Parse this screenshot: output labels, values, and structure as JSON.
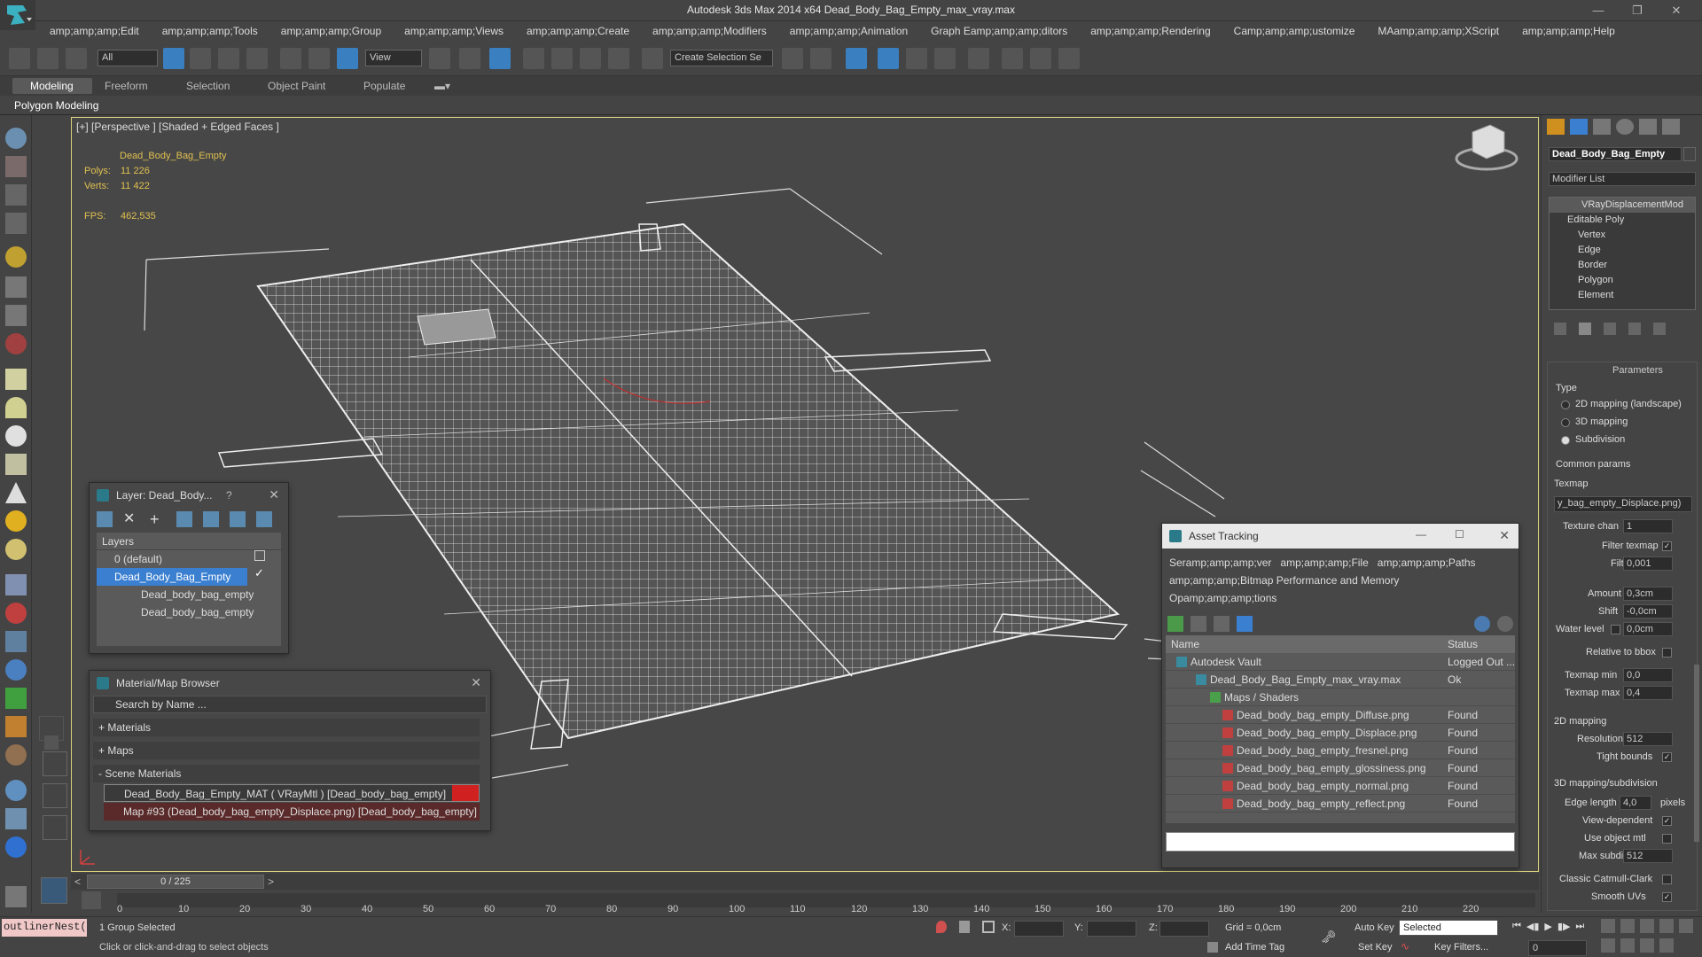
{
  "window": {
    "title": "Autodesk 3ds Max  2014 x64    Dead_Body_Bag_Empty_max_vray.max"
  },
  "menu": [
    "amp;amp;amp;Edit",
    "amp;amp;amp;Tools",
    "amp;amp;amp;Group",
    "amp;amp;amp;Views",
    "amp;amp;amp;Create",
    "amp;amp;amp;Modifiers",
    "amp;amp;amp;Animation",
    "Graph Eamp;amp;amp;ditors",
    "amp;amp;amp;Rendering",
    "Camp;amp;amp;ustomize",
    "MAamp;amp;amp;XScript",
    "amp;amp;amp;Help"
  ],
  "toolbar": {
    "filter": "All",
    "ref_coord": "View",
    "selection_set": "Create Selection Se"
  },
  "ribbon": {
    "tabs": [
      "Modeling",
      "Freeform",
      "Selection",
      "Object Paint",
      "Populate"
    ],
    "sub": "Polygon Modeling"
  },
  "viewport": {
    "label": "[+] [Perspective ] [Shaded + Edged Faces ]",
    "object": "Dead_Body_Bag_Empty",
    "polys_label": "Polys:",
    "polys": "11 226",
    "verts_label": "Verts:",
    "verts": "11 422",
    "fps_label": "FPS:",
    "fps": "462,535"
  },
  "layer_dlg": {
    "title": "Layer: Dead_Body...",
    "help": "?",
    "header": "Layers",
    "rows": [
      "0 (default)",
      "Dead_Body_Bag_Empty",
      "Dead_body_bag_empty",
      "Dead_body_bag_empty"
    ]
  },
  "mat_dlg": {
    "title": "Material/Map Browser",
    "search": "Search by Name ...",
    "sections": [
      "+ Materials",
      "+ Maps",
      "- Scene Materials"
    ],
    "items": [
      "Dead_Body_Bag_Empty_MAT ( VRayMtl ) [Dead_body_bag_empty]",
      "Map #93 (Dead_body_bag_empty_Displace.png) [Dead_body_bag_empty]"
    ]
  },
  "asset_dlg": {
    "title": "Asset Tracking",
    "menu": [
      "Seramp;amp;amp;ver",
      "amp;amp;amp;File",
      "amp;amp;amp;Paths",
      "amp;amp;amp;Bitmap Performance and Memory",
      "Opamp;amp;amp;tions"
    ],
    "col_name": "Name",
    "col_status": "Status",
    "rows": [
      {
        "name": "Autodesk Vault",
        "status": "Logged Out ..."
      },
      {
        "name": "Dead_Body_Bag_Empty_max_vray.max",
        "status": "Ok"
      },
      {
        "name": "Maps / Shaders",
        "status": ""
      },
      {
        "name": "Dead_body_bag_empty_Diffuse.png",
        "status": "Found"
      },
      {
        "name": "Dead_body_bag_empty_Displace.png",
        "status": "Found"
      },
      {
        "name": "Dead_body_bag_empty_fresnel.png",
        "status": "Found"
      },
      {
        "name": "Dead_body_bag_empty_glossiness.png",
        "status": "Found"
      },
      {
        "name": "Dead_body_bag_empty_normal.png",
        "status": "Found"
      },
      {
        "name": "Dead_body_bag_empty_reflect.png",
        "status": "Found"
      }
    ]
  },
  "panel": {
    "object": "Dead_Body_Bag_Empty",
    "modifier_list": "Modifier List",
    "stack": [
      "VRayDisplacementMod",
      "Editable Poly",
      "Vertex",
      "Edge",
      "Border",
      "Polygon",
      "Element"
    ],
    "params": "Parameters",
    "type": "Type",
    "type_opts": [
      "2D mapping (landscape)",
      "3D mapping",
      "Subdivision"
    ],
    "common": "Common params",
    "texmap": "Texmap",
    "texmap_val": "y_bag_empty_Displace.png)",
    "texture_chan": "Texture chan",
    "texture_chan_val": "1",
    "filter_texmap": "Filter texmap",
    "filter_blur": "Filter blur",
    "filter_blur_val": "0,001",
    "amount": "Amount",
    "amount_val": "0,3cm",
    "shift": "Shift",
    "shift_val": "-0,0cm",
    "water": "Water level",
    "water_val": "0,0cm",
    "rel_bbox": "Relative to bbox",
    "tex_min": "Texmap min",
    "tex_min_val": "0,0",
    "tex_max": "Texmap max",
    "tex_max_val": "0,4",
    "mapping2d": "2D mapping",
    "resolution": "Resolution",
    "resolution_val": "512",
    "tight": "Tight bounds",
    "mapping3d": "3D mapping/subdivision",
    "edge_len": "Edge length",
    "edge_len_val": "4,0",
    "pixels": "pixels",
    "view_dep": "View-dependent",
    "use_obj": "Use object mtl",
    "max_subdivs": "Max subdivs",
    "max_subdivs_val": "512",
    "catmull": "Classic Catmull-Clark",
    "smooth_uv": "Smooth UVs"
  },
  "timeline": {
    "frame": "0 / 225",
    "ticks": [
      "0",
      "10",
      "20",
      "30",
      "40",
      "50",
      "60",
      "70",
      "80",
      "90",
      "100",
      "110",
      "120",
      "130",
      "140",
      "150",
      "160",
      "170",
      "180",
      "190",
      "200",
      "210",
      "220"
    ]
  },
  "status": {
    "script": "outlinerNest(",
    "selected": "1 Group Selected",
    "prompt": "Click or click-and-drag to select objects",
    "x": "X:",
    "y": "Y:",
    "z": "Z:",
    "grid": "Grid = 0,0cm",
    "add_time": "Add Time Tag",
    "auto_key": "Auto Key",
    "sel_mode": "Selected",
    "set_key": "Set Key",
    "key_filters": "Key Filters...",
    "frame_val": "0"
  }
}
